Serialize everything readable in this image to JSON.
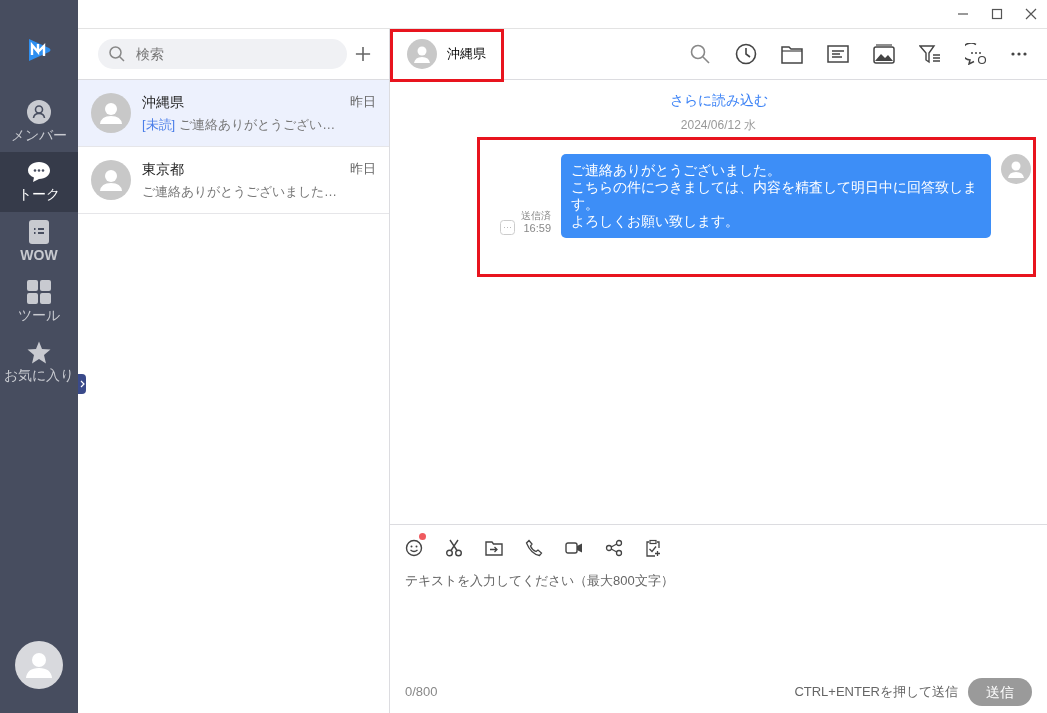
{
  "sidebar": {
    "items": [
      {
        "kind": "member",
        "label": "メンバー",
        "selected": false
      },
      {
        "kind": "talk",
        "label": "トーク",
        "selected": true
      },
      {
        "kind": "wow",
        "label": "WOW",
        "selected": false
      },
      {
        "kind": "tools",
        "label": "ツール",
        "selected": false
      },
      {
        "kind": "favorites",
        "label": "お気に入り",
        "selected": false
      }
    ]
  },
  "chat_list": {
    "search_placeholder": "検索",
    "conversations": [
      {
        "name": "沖縄県",
        "time": "昨日",
        "unread_tag": "[未読]",
        "preview": "ご連絡ありがとうござい…",
        "selected": true
      },
      {
        "name": "東京都",
        "time": "昨日",
        "preview": "ご連絡ありがとうございました…",
        "selected": false
      }
    ]
  },
  "chat": {
    "header_name": "沖縄県",
    "load_more": "さらに読み込む",
    "date": "2024/06/12 水",
    "messages": [
      {
        "lines": [
          "ご連絡ありがとうございました。",
          "こちらの件につきましては、内容を精査して明日中に回答致します。",
          "よろしくお願い致します。"
        ],
        "status": "送信済",
        "time": "16:59"
      }
    ]
  },
  "composer": {
    "emoji_badge": true,
    "placeholder": "テキストを入力してください（最大800文字）",
    "counter": "0/800",
    "hint": "CTRL+ENTERを押して送信",
    "send_label": "送信",
    "send_disabled": true
  }
}
